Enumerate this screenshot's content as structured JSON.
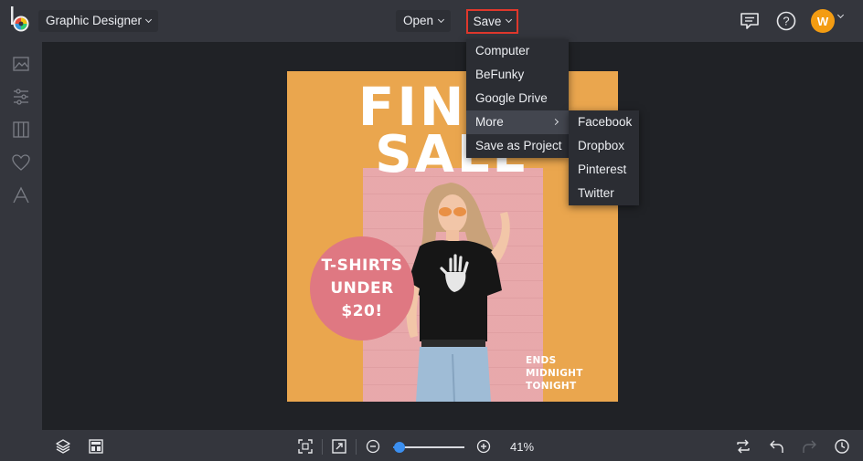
{
  "app": {
    "brand_icon": "befunky-logo",
    "mode_label": "Graphic Designer"
  },
  "toolbar": {
    "open_label": "Open",
    "save_label": "Save",
    "icons": [
      "comment-icon",
      "help-icon",
      "avatar"
    ],
    "avatar_initial": "W"
  },
  "save_menu": {
    "items": [
      {
        "label": "Computer"
      },
      {
        "label": "BeFunky"
      },
      {
        "label": "Google Drive"
      },
      {
        "label": "More"
      },
      {
        "label": "Save as Project"
      }
    ]
  },
  "more_submenu": {
    "items": [
      {
        "label": "Facebook"
      },
      {
        "label": "Dropbox"
      },
      {
        "label": "Pinterest"
      },
      {
        "label": "Twitter"
      }
    ]
  },
  "sidebar": {
    "icons": [
      "image-icon",
      "sliders-icon",
      "layout-columns-icon",
      "heart-icon",
      "text-icon"
    ]
  },
  "poster": {
    "title_line1": "FINAL",
    "title_line2": "SALE",
    "circle_line1": "T-SHIRTS",
    "circle_line2": "UNDER",
    "circle_line3": "$20!",
    "ends_line1": "ENDS",
    "ends_line2": "MIDNIGHT",
    "ends_line3": "TONIGHT",
    "background_color": "#eaa64e",
    "accent_color": "#df7882"
  },
  "bottombar": {
    "zoom_value": "41%",
    "zoom_fraction": 0.04
  },
  "colors": {
    "save_highlight": "#e0382c",
    "accent": "#3b8ff0",
    "avatar": "#f39c12"
  }
}
